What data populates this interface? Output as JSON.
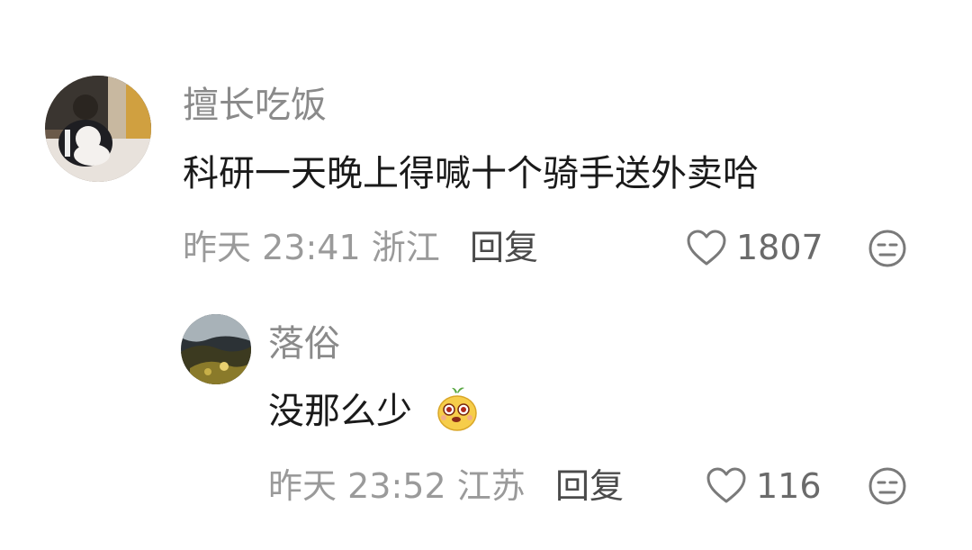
{
  "comments": [
    {
      "username": "擅长吃饭",
      "text": "科研一天晚上得喊十个骑手送外卖哈",
      "date": "昨天",
      "time": "23:41",
      "location": "浙江",
      "reply_label": "回复",
      "like_count": "1807",
      "avatar_icon": "avatar-photo-person-with-dog",
      "like_icon": "heart-outline-icon",
      "dislike_icon": "meh-face-icon"
    },
    {
      "username": "落俗",
      "text": "没那么少",
      "emoji_icon": "cute-yellow-face-emoji",
      "date": "昨天",
      "time": "23:52",
      "location": "江苏",
      "reply_label": "回复",
      "like_count": "116",
      "avatar_icon": "avatar-photo-landscape",
      "like_icon": "heart-outline-icon",
      "dislike_icon": "meh-face-icon"
    }
  ],
  "colors": {
    "username": "#8a8a8a",
    "content": "#1a1a1a",
    "meta": "#9a9a9a",
    "icon": "#7a7a7a"
  }
}
